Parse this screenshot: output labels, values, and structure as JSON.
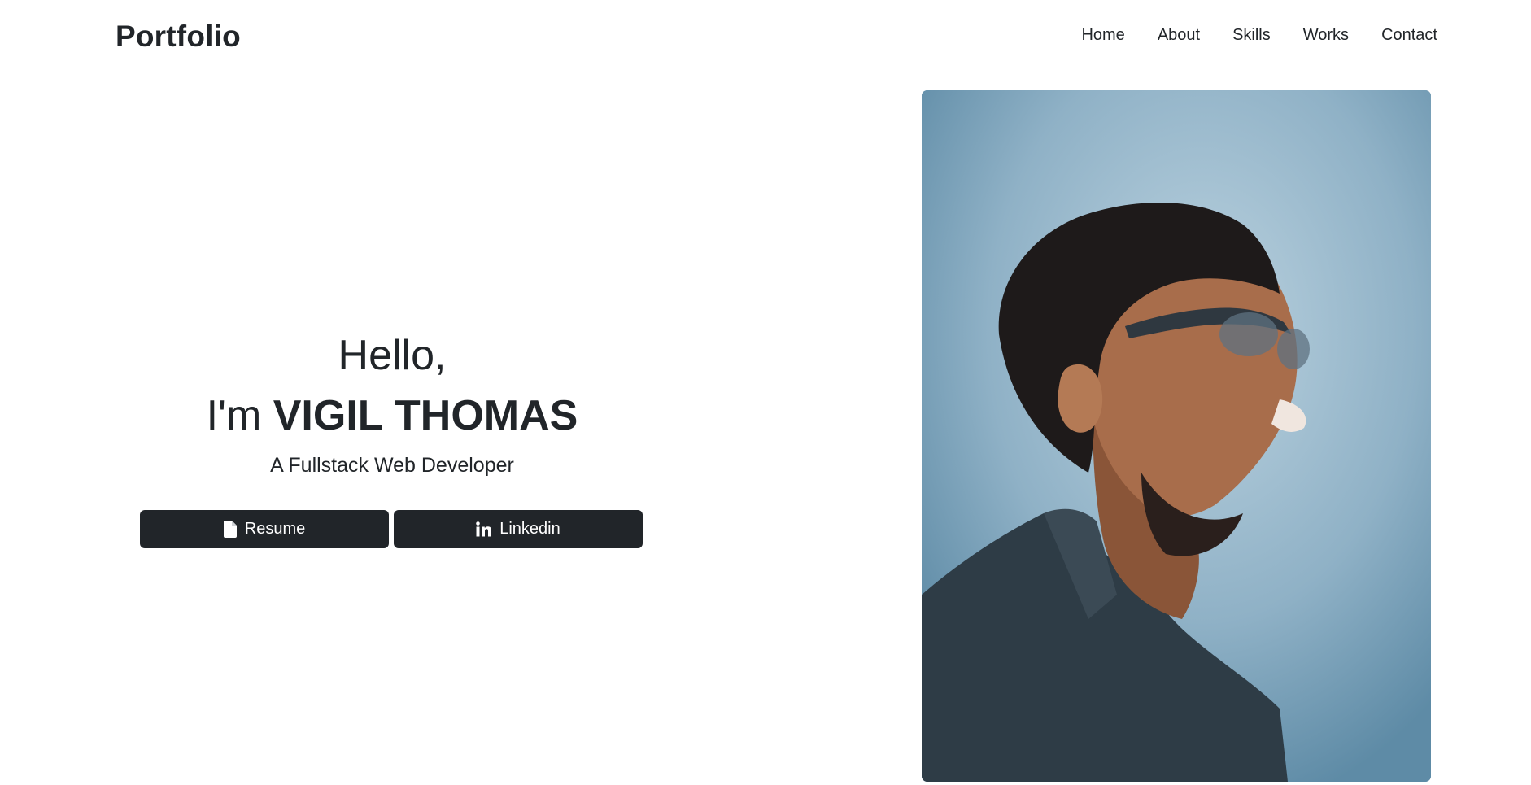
{
  "header": {
    "brand": "Portfolio",
    "nav": [
      "Home",
      "About",
      "Skills",
      "Works",
      "Contact"
    ]
  },
  "hero": {
    "greeting": "Hello,",
    "intro_prefix": "I'm ",
    "name": "VIGIL THOMAS",
    "role": "A Fullstack Web Developer",
    "buttons": {
      "resume": "Resume",
      "linkedin": "Linkedin"
    }
  },
  "icons": {
    "resume": "file-icon",
    "linkedin": "linkedin-icon"
  },
  "colors": {
    "text": "#212529",
    "button_bg": "#212529",
    "button_text": "#ffffff",
    "background": "#ffffff"
  }
}
